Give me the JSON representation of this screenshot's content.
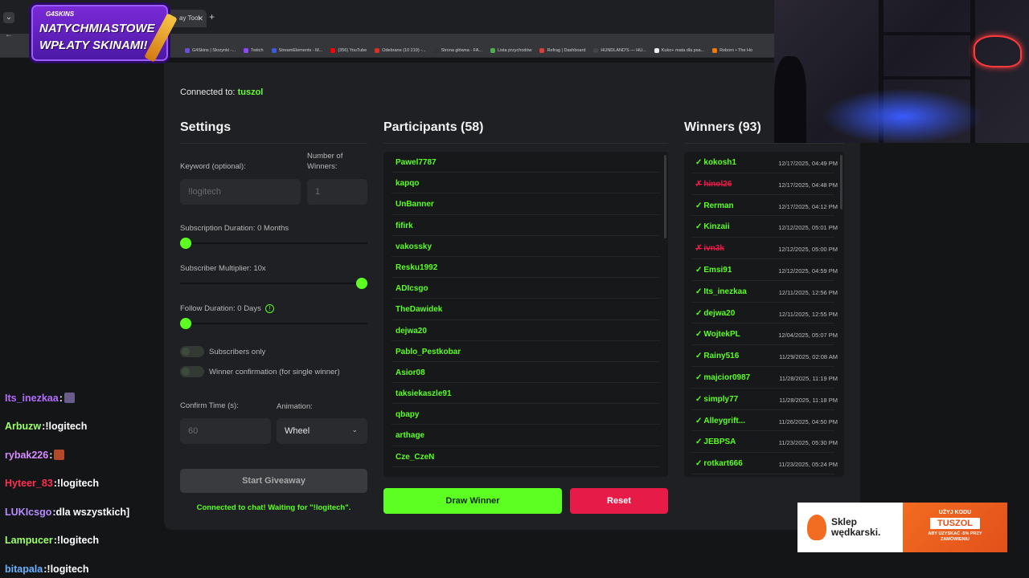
{
  "browser": {
    "active_tab_title": "ay Tool",
    "bookmarks": [
      {
        "label": "G4Skins | Skrzynki -...",
        "color": "#6b4fd8"
      },
      {
        "label": "Twitch",
        "color": "#9146ff"
      },
      {
        "label": "StreamElements - M...",
        "color": "#3b5bdb"
      },
      {
        "label": "(356) YouTube",
        "color": "#ff0000"
      },
      {
        "label": "Odebrane (10 219) -...",
        "color": "#d93025"
      },
      {
        "label": "Strona główna - FA...",
        "color": "#333333"
      },
      {
        "label": "Lista przychodów",
        "color": "#4caf50"
      },
      {
        "label": "Refrag | Dashboard",
        "color": "#e53935"
      },
      {
        "label": "HUNDLAND'S — HU...",
        "color": "#444444"
      },
      {
        "label": "Kuko+ mata dla psa...",
        "color": "#eeeeee"
      },
      {
        "label": "Reborn • The Ho",
        "color": "#f57c00"
      }
    ]
  },
  "promo": {
    "brand": "G4SKINS",
    "line1": "NATYCHMIASTOWE",
    "line2": "WPŁATY SKINAMI!"
  },
  "chat": [
    {
      "user": "Its_inezkaa",
      "sep": ":",
      "text": "",
      "color": "#b56cff",
      "emote": "#6a5c8a"
    },
    {
      "user": "Arbuzw",
      "sep": ":",
      "text": " !logitech",
      "color": "#9cff6b"
    },
    {
      "user": "rybak226",
      "sep": ":",
      "text": "",
      "color": "#d78cff",
      "emote": "#b24a2a"
    },
    {
      "user": "Hyteer_83",
      "sep": ":",
      "text": " !logitech",
      "color": "#ff2f4f"
    },
    {
      "user": "LUKIcsgo",
      "sep": ":",
      "text": " dla wszystkich]",
      "color": "#b68cff"
    },
    {
      "user": "Lampucer",
      "sep": ":",
      "text": " !logitech",
      "color": "#9cff6b"
    },
    {
      "user": "bitapala",
      "sep": ":",
      "text": " !logitech",
      "color": "#6bb3ff"
    }
  ],
  "app": {
    "connected_label": "Connected to: ",
    "channel": "tuszol",
    "settings": {
      "title": "Settings",
      "keyword_label": "Keyword (optional):",
      "keyword_placeholder": "!logitech",
      "winners_label": "Number of Winners:",
      "winners_value": "1",
      "sub_duration_label": "Subscription Duration: 0 Months",
      "sub_duration_value": 0,
      "sub_multiplier_label": "Subscriber Multiplier: 10x",
      "sub_multiplier_value": 10,
      "follow_duration_label": "Follow Duration: 0 Days",
      "follow_duration_value": 0,
      "subscribers_only_label": "Subscribers only",
      "winner_confirmation_label": "Winner confirmation (for single winner)",
      "confirm_time_label": "Confirm Time (s):",
      "confirm_time_value": "60",
      "animation_label": "Animation:",
      "animation_value": "Wheel",
      "start_button": "Start Giveaway",
      "status": "Connected to chat! Waiting for \"!logitech\"."
    },
    "participants": {
      "title": "Participants (58)",
      "items": [
        "Pawel7787",
        "kapqo",
        "UnBanner",
        "fifirk",
        "vakossky",
        "Resku1992",
        "ADIcsgo",
        "TheDawidek",
        "dejwa20",
        "Pablo_Pestkobar",
        "Asior08",
        "taksiekaszle91",
        "qbapy",
        "arthage",
        "Cze_CzeN"
      ],
      "draw_button": "Draw Winner",
      "reset_button": "Reset"
    },
    "winners": {
      "title": "Winners (93)",
      "items": [
        {
          "mark": "✓",
          "name": "kokosh1",
          "date": "12/17/2025, 04:49 PM",
          "confirmed": true
        },
        {
          "mark": "✗",
          "name": "hinol26",
          "date": "12/17/2025, 04:48 PM",
          "confirmed": false
        },
        {
          "mark": "✓",
          "name": "Rerman",
          "date": "12/17/2025, 04:12 PM",
          "confirmed": true
        },
        {
          "mark": "✓",
          "name": "Kinzaii",
          "date": "12/12/2025, 05:01 PM",
          "confirmed": true
        },
        {
          "mark": "✗",
          "name": "ivn3k",
          "date": "12/12/2025, 05:00 PM",
          "confirmed": false
        },
        {
          "mark": "✓",
          "name": "Emsi91",
          "date": "12/12/2025, 04:59 PM",
          "confirmed": true
        },
        {
          "mark": "✓",
          "name": "Its_inezkaa",
          "date": "12/11/2025, 12:56 PM",
          "confirmed": true
        },
        {
          "mark": "✓",
          "name": "dejwa20",
          "date": "12/11/2025, 12:55 PM",
          "confirmed": true
        },
        {
          "mark": "✓",
          "name": "WojtekPL",
          "date": "12/04/2025, 05:07 PM",
          "confirmed": true
        },
        {
          "mark": "✓",
          "name": "Rainy516",
          "date": "11/29/2025, 02:08 AM",
          "confirmed": true
        },
        {
          "mark": "✓",
          "name": "majcior0987",
          "date": "11/28/2025, 11:19 PM",
          "confirmed": true
        },
        {
          "mark": "✓",
          "name": "simply77",
          "date": "11/28/2025, 11:18 PM",
          "confirmed": true
        },
        {
          "mark": "✓",
          "name": "Alleygrift...",
          "date": "11/26/2025, 04:50 PM",
          "confirmed": true
        },
        {
          "mark": "✓",
          "name": "JEBPSA",
          "date": "11/23/2025, 05:30 PM",
          "confirmed": true
        },
        {
          "mark": "✓",
          "name": "rotkart666",
          "date": "11/23/2025, 05:24 PM",
          "confirmed": true
        }
      ]
    }
  },
  "sponsor": {
    "name_line1": "Sklep",
    "name_line2": "wędkarski.",
    "use_code": "UŻYJ KODU",
    "code": "TUSZOL",
    "note": "ABY UZYSKAĆ -5% PRZY ZAMÓWIENIU"
  },
  "colors": {
    "accent": "#5cff21",
    "danger": "#e61b47",
    "panel": "#1f2023"
  }
}
